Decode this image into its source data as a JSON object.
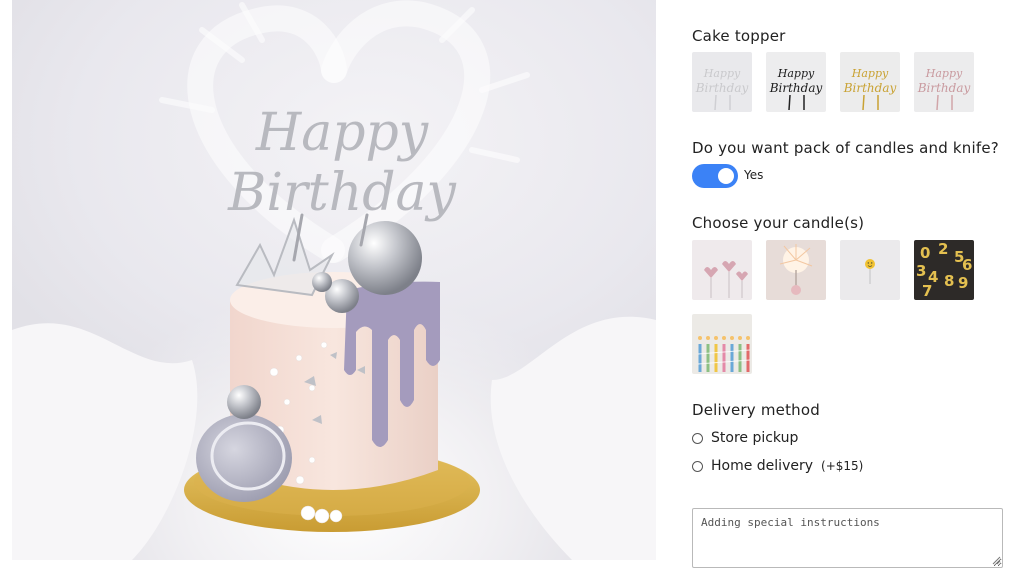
{
  "product_photo": {
    "alt": "Happy Birthday cake with silver balls, purple drip and macaron",
    "topper_text_line1": "Happy",
    "topper_text_line2": "Birthday"
  },
  "cake_topper": {
    "title": "Cake topper",
    "options": [
      {
        "name": "clear-acrylic",
        "line1": "Happy",
        "line2": "Birthday",
        "color": "#c9c9cc"
      },
      {
        "name": "black-acrylic",
        "line1": "Happy",
        "line2": "Birthday",
        "color": "#1c1c1c"
      },
      {
        "name": "gold-acrylic",
        "line1": "Happy",
        "line2": "Birthday",
        "color": "#c9a233"
      },
      {
        "name": "rose-gold-acrylic",
        "line1": "Happy",
        "line2": "Birthday",
        "color": "#c99a9f"
      }
    ]
  },
  "candles_knife": {
    "question": "Do you want pack of candles and knife?",
    "toggle_on": true,
    "toggle_label": "Yes",
    "accent_color": "#3b82f6"
  },
  "candles": {
    "title": "Choose your candle(s)",
    "options": [
      {
        "name": "heart-candles"
      },
      {
        "name": "sparkler-candle"
      },
      {
        "name": "smiley-candle"
      },
      {
        "name": "number-candles",
        "digits": "0123456789"
      },
      {
        "name": "striped-candles"
      }
    ]
  },
  "delivery": {
    "title": "Delivery method",
    "options": [
      {
        "label": "Store pickup",
        "extra": ""
      },
      {
        "label": "Home delivery",
        "extra": "(+$15)"
      }
    ]
  },
  "instructions": {
    "placeholder": "Adding special instructions",
    "value": ""
  }
}
